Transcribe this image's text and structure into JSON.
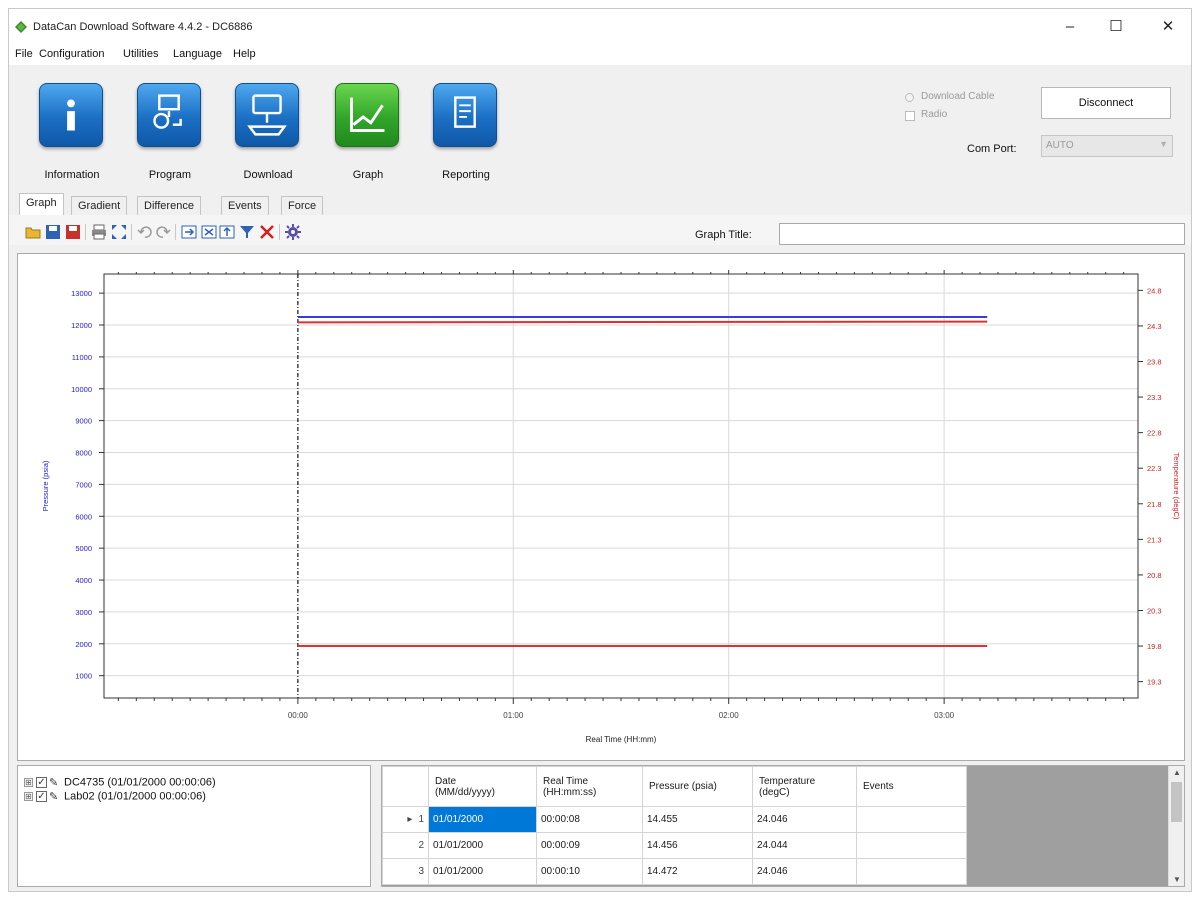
{
  "window": {
    "title": "DataCan Download Software 4.4.2 - DC6886",
    "controls": {
      "minimize": "–",
      "maximize": "☐",
      "close": "✕"
    }
  },
  "menu": [
    "File",
    "Configuration",
    "Utilities",
    "Language",
    "Help"
  ],
  "ribbon": {
    "buttons": [
      {
        "label": "Information",
        "icon": "info-icon",
        "color": "#1b6fc4"
      },
      {
        "label": "Program",
        "icon": "program-icon",
        "color": "#1b6fc4"
      },
      {
        "label": "Download",
        "icon": "download-icon",
        "color": "#1b6fc4"
      },
      {
        "label": "Graph",
        "icon": "graph-icon",
        "color": "#31a52a"
      },
      {
        "label": "Reporting",
        "icon": "reporting-icon",
        "color": "#1b6fc4"
      }
    ],
    "connection": {
      "download_cable": "Download Cable",
      "radio": "Radio",
      "disconnect": "Disconnect",
      "com_port_label": "Com Port:",
      "com_port_value": "AUTO"
    }
  },
  "tabs": [
    "Graph",
    "Gradient",
    "Difference",
    "Events",
    "Force"
  ],
  "active_tab": "Graph",
  "toolbar": {
    "icons": [
      "open-folder-icon",
      "save-icon",
      "save-red-icon",
      "print-icon",
      "fit-icon",
      "undo-icon",
      "redo-icon",
      "export-icon",
      "zoom-x-icon",
      "zoom-y-icon",
      "filter-icon",
      "delete-icon",
      "settings-icon"
    ],
    "graph_title_label": "Graph Title:",
    "graph_title_value": ""
  },
  "chart_data": {
    "type": "line",
    "xlabel": "Real Time (HH:mm)",
    "ylabel_left": "Pressure (psia)",
    "ylabel_right": "Temperature (degC)",
    "x_ticks": [
      "00:00",
      "01:00",
      "02:00",
      "03:00"
    ],
    "x_range_hours": [
      -0.9,
      3.9
    ],
    "y_left_ticks": [
      13000,
      12000,
      11000,
      10000,
      9000,
      8000,
      7000,
      6000,
      5000,
      4000,
      3000,
      2000,
      1000
    ],
    "y_left_range": [
      300,
      13600
    ],
    "y_right_ticks": [
      "24.8",
      "24.3",
      "23.8",
      "23.3",
      "22.8",
      "22.3",
      "21.8",
      "21.3",
      "20.8",
      "20.3",
      "19.8",
      "19.3"
    ],
    "y_right_range": [
      19.07,
      25.03
    ],
    "grid": true,
    "left_axis_color": "#2222cc",
    "right_axis_color": "#cc2222",
    "cursor_x_hours": 0.0,
    "series": [
      {
        "color": "#3a3ae0",
        "axis": "left",
        "x_hours": [
          0.0,
          3.2
        ],
        "values": [
          12250,
          12250
        ]
      },
      {
        "color": "#e03030",
        "axis": "right",
        "x_hours": [
          0.0,
          3.2
        ],
        "values": [
          24.35,
          24.36
        ]
      },
      {
        "color": "#e03030",
        "axis": "left",
        "x_hours": [
          0.0,
          3.2
        ],
        "values": [
          1930,
          1930
        ]
      }
    ]
  },
  "tree": [
    {
      "expander": "⊞",
      "checked": "✓",
      "label": "DC4735 (01/01/2000 00:00:06)"
    },
    {
      "expander": "⊞",
      "checked": "✓",
      "label": "Lab02 (01/01/2000 00:00:06)"
    }
  ],
  "grid": {
    "headers": [
      "Date\n(MM/dd/yyyy)",
      "Real Time\n(HH:mm:ss)",
      "Pressure (psia)",
      "Temperature\n(degC)",
      "Events"
    ],
    "rows": [
      {
        "num": "1",
        "date": "01/01/2000",
        "time": "00:00:08",
        "pressure": "14.455",
        "temperature": "24.046",
        "events": ""
      },
      {
        "num": "2",
        "date": "01/01/2000",
        "time": "00:00:09",
        "pressure": "14.456",
        "temperature": "24.044",
        "events": ""
      },
      {
        "num": "3",
        "date": "01/01/2000",
        "time": "00:00:10",
        "pressure": "14.472",
        "temperature": "24.046",
        "events": ""
      }
    ],
    "current_row_marker": "▸",
    "scroll_up": "▲",
    "scroll_down": "▼"
  }
}
